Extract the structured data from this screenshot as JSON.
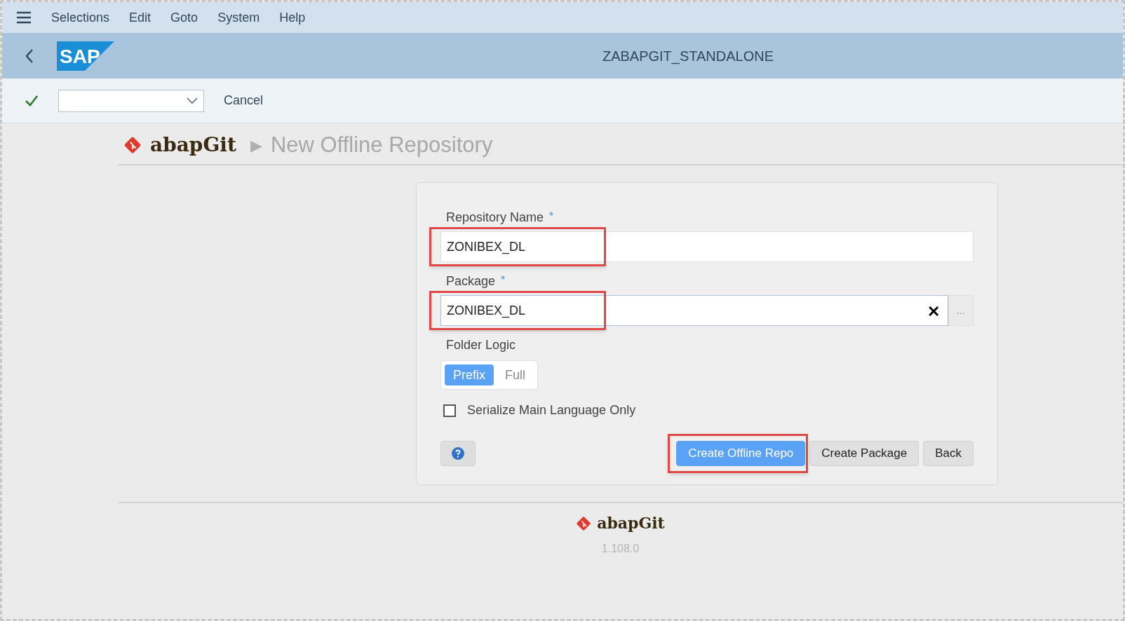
{
  "menu": [
    "Selections",
    "Edit",
    "Goto",
    "System",
    "Help"
  ],
  "header": {
    "logo": "SAP",
    "title": "ZABAPGIT_STANDALONE"
  },
  "toolbar": {
    "cancel": "Cancel"
  },
  "page": {
    "brand": "abapGit",
    "separator": "▶",
    "title": "New Offline Repository"
  },
  "form": {
    "fields": [
      {
        "label": "Repository Name",
        "required_mark": "*",
        "value": "ZONIBEX_DL",
        "kind": "text",
        "highlighted": true
      },
      {
        "label": "Package",
        "required_mark": "*",
        "value": "ZONIBEX_DL",
        "kind": "lookup",
        "clear": "✕",
        "lookup": "...",
        "highlighted": true
      }
    ],
    "folder_logic": {
      "label": "Folder Logic",
      "options": [
        {
          "label": "Prefix",
          "selected": true
        },
        {
          "label": "Full",
          "selected": false
        }
      ]
    },
    "checkbox": {
      "label": "Serialize Main Language Only",
      "checked": false
    },
    "buttons": [
      {
        "label": "Create Offline Repo",
        "kind": "primary",
        "highlighted": true
      },
      {
        "label": "Create Package",
        "kind": "secondary",
        "highlighted": false
      },
      {
        "label": "Back",
        "kind": "secondary",
        "highlighted": false
      }
    ]
  },
  "footer": {
    "brand": "abapGit",
    "version": "1.108.0"
  }
}
